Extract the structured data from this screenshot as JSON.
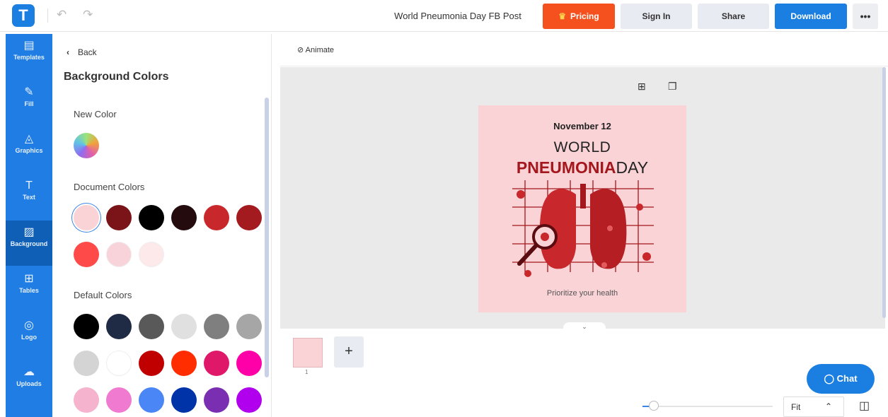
{
  "app": {
    "logo_letter": "T",
    "document_title": "World Pneumonia Day FB Post",
    "undo_icon": "undo-icon",
    "redo_icon": "redo-icon"
  },
  "toolbar": {
    "pricing_label": "Pricing",
    "signin_label": "Sign In",
    "share_label": "Share",
    "download_label": "Download",
    "more_label": "•••"
  },
  "sidebar": {
    "items": [
      {
        "label": "Templates",
        "icon": "templates-icon",
        "glyph": "▤"
      },
      {
        "label": "Fill",
        "icon": "pencil-icon",
        "glyph": "✎"
      },
      {
        "label": "Graphics",
        "icon": "shapes-icon",
        "glyph": "◬"
      },
      {
        "label": "Text",
        "icon": "text-icon",
        "glyph": "T"
      },
      {
        "label": "Background",
        "icon": "background-icon",
        "glyph": "▨",
        "active": true
      },
      {
        "label": "Tables",
        "icon": "table-icon",
        "glyph": "⊞"
      },
      {
        "label": "Logo",
        "icon": "logo-icon",
        "glyph": "◎"
      },
      {
        "label": "Uploads",
        "icon": "cloud-upload-icon",
        "glyph": "☁"
      }
    ]
  },
  "panel": {
    "back_label": "Back",
    "title": "Background Colors",
    "new_color_label": "New Color",
    "document_colors_label": "Document Colors",
    "default_colors_label": "Default Colors",
    "document_colors": [
      "#fad3d6",
      "#7a1418",
      "#000000",
      "#240c0e",
      "#c8282c",
      "#a31b1f",
      "#ff4a4a",
      "#f9d3da",
      "#fde8ea"
    ],
    "default_colors": [
      "#000000",
      "#1f2a44",
      "#595959",
      "#e0e0e0",
      "#7f7f7f",
      "#a6a6a6",
      "#d4d4d4",
      "#ffffff",
      "#c00000",
      "#ff2d00",
      "#e0186a",
      "#ff00a8",
      "#f5b3ce",
      "#f07ad0",
      "#4a86f5",
      "#0033a8",
      "#7a2fb3",
      "#b100ee"
    ],
    "selected_color": "#fad3d6"
  },
  "canvas": {
    "animate_label": "Animate",
    "card": {
      "date": "November 12",
      "line1": "WORLD",
      "line2_bold": "PNEUMONIA",
      "line2_rest": "DAY",
      "tagline": "Prioritize your health",
      "bg_color": "#fad3d6",
      "accent_color": "#a3171d"
    },
    "page_number": "1",
    "add_page_label": "+",
    "chat_label": "Chat",
    "zoom_value": "Fit",
    "zoom_level_fraction": 0.06
  }
}
